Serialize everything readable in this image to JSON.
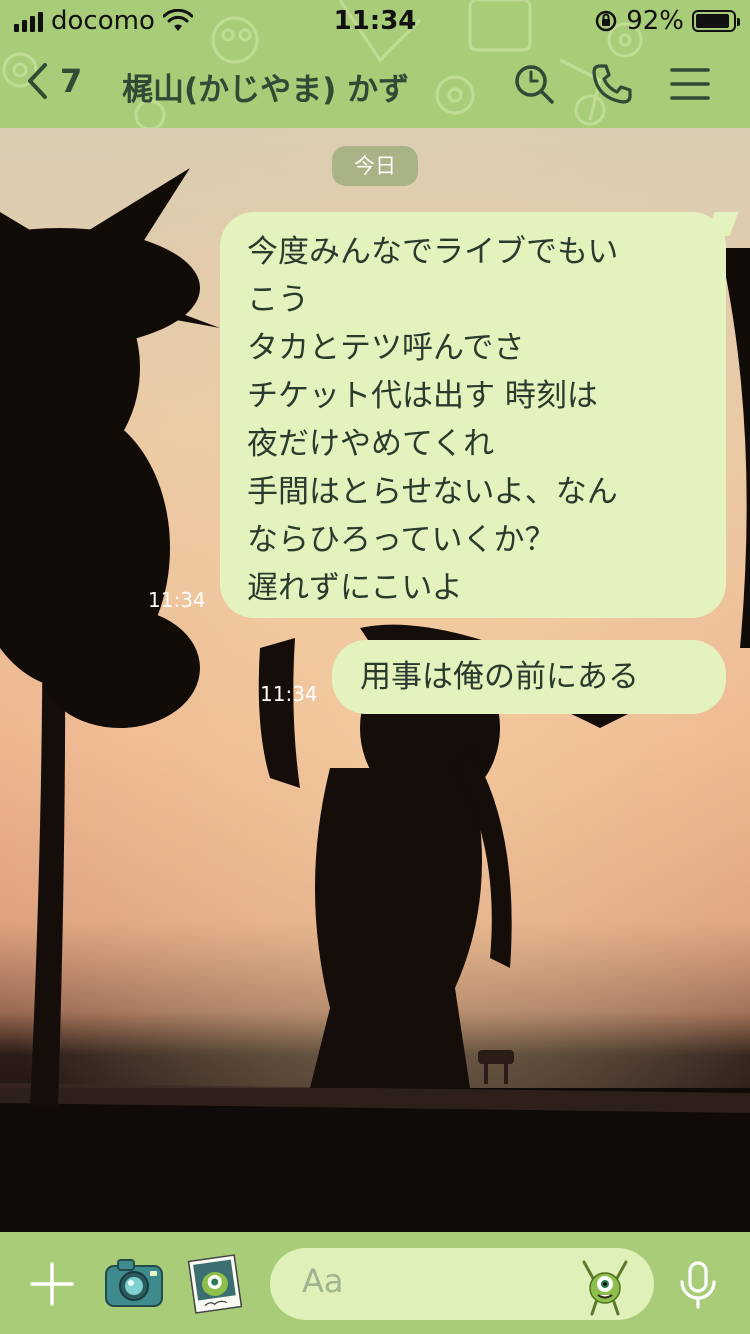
{
  "status_bar": {
    "carrier": "docomo",
    "time": "11:34",
    "battery_percent": "92%",
    "battery_level": 0.92
  },
  "header": {
    "back_count": "7",
    "title": "梶山(かじやま) かず"
  },
  "chat": {
    "date_label": "今日",
    "messages": [
      {
        "lines": [
          "今度みんなでライブでもい",
          "こう",
          "タカとテツ呼んでさ",
          "チケット代は出す 時刻は",
          "夜だけやめてくれ",
          "手間はとらせないよ、なん",
          "ならひろっていくか？",
          "遅れずにこいよ"
        ],
        "time": "11:34"
      },
      {
        "lines": [
          "用事は俺の前にある"
        ],
        "time": "11:34"
      }
    ]
  },
  "input_bar": {
    "placeholder": "Aa"
  },
  "colors": {
    "header_green": "#a9cc78",
    "bubble_green": "#e4f3bd",
    "title_text": "#2f4a35"
  },
  "icons": [
    "back-chevron-icon",
    "search-icon",
    "phone-icon",
    "menu-icon",
    "plus-icon",
    "camera-icon",
    "photo-icon",
    "sticker-icon",
    "mic-icon"
  ]
}
